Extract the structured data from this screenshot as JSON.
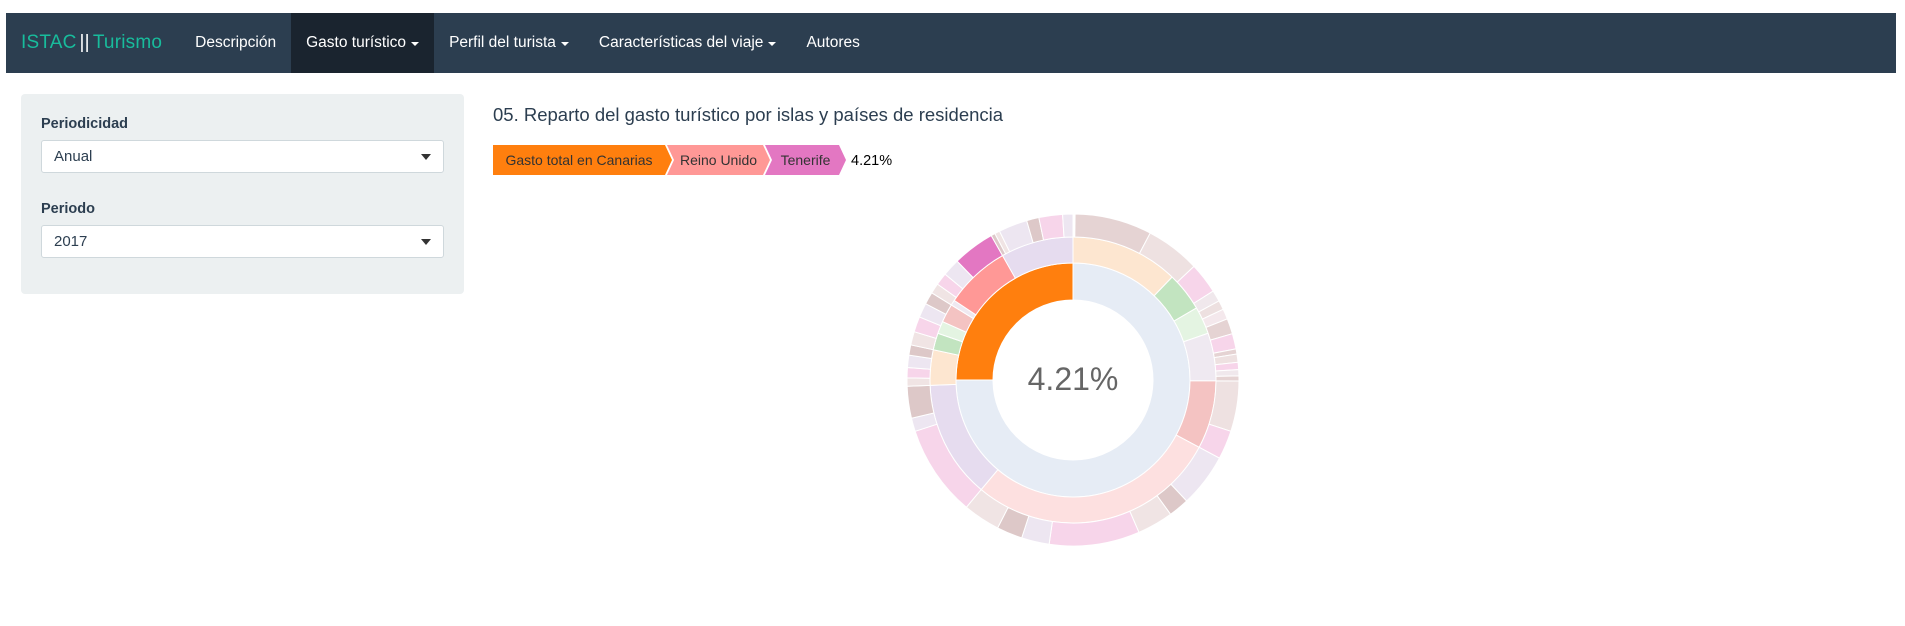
{
  "navbar": {
    "brand_left": "ISTAC",
    "brand_sep": "||",
    "brand_right": "Turismo",
    "items": [
      {
        "label": "Descripción",
        "dropdown": false,
        "active": false
      },
      {
        "label": "Gasto turístico",
        "dropdown": true,
        "active": true
      },
      {
        "label": "Perfil del turista",
        "dropdown": true,
        "active": false
      },
      {
        "label": "Características del viaje",
        "dropdown": true,
        "active": false
      },
      {
        "label": "Autores",
        "dropdown": false,
        "active": false
      }
    ]
  },
  "sidebar": {
    "periodicidad_label": "Periodicidad",
    "periodicidad_value": "Anual",
    "periodo_label": "Periodo",
    "periodo_value": "2017"
  },
  "main": {
    "title": "05. Reparto del gasto turístico por islas y países de residencia"
  },
  "colors": {
    "navbar": "#2c3e50",
    "brand": "#18bc9c",
    "highlight_total": "#ff7f0e",
    "highlight_country": "#ff9896",
    "highlight_island": "#e377c2"
  },
  "chart_data": {
    "type": "sunburst",
    "center_label": "4.21%",
    "breadcrumb": [
      {
        "label": "Gasto total en Canarias",
        "color": "#ff7f0e"
      },
      {
        "label": "Reino Unido",
        "color": "#ff9896"
      },
      {
        "label": "Tenerife",
        "color": "#e377c2"
      }
    ],
    "breadcrumb_value": "4.21%",
    "highlighted_path": [
      "Gasto total en Canarias",
      "Reino Unido",
      "Tenerife"
    ],
    "rings": [
      {
        "level": 1,
        "segments": [
          {
            "start": 0.0,
            "end": 0.75,
            "color": "#e6ecf5"
          },
          {
            "start": 0.75,
            "end": 1.0,
            "color": "#ff7f0e"
          }
        ]
      },
      {
        "level": 2,
        "segments": [
          {
            "start": 0.0,
            "end": 0.122,
            "color": "#fde6d0"
          },
          {
            "start": 0.122,
            "end": 0.166,
            "color": "#c2e4c0"
          },
          {
            "start": 0.166,
            "end": 0.197,
            "color": "#e4f4e2"
          },
          {
            "start": 0.197,
            "end": 0.251,
            "color": "#efe9f1"
          },
          {
            "start": 0.251,
            "end": 0.328,
            "color": "#f4c3c2"
          },
          {
            "start": 0.328,
            "end": 0.611,
            "color": "#fde0e0"
          },
          {
            "start": 0.611,
            "end": 0.744,
            "color": "#e6dcef"
          },
          {
            "start": 0.744,
            "end": 0.784,
            "color": "#fde6d0"
          },
          {
            "start": 0.784,
            "end": 0.803,
            "color": "#c2e4c0"
          },
          {
            "start": 0.803,
            "end": 0.817,
            "color": "#e4f4e2"
          },
          {
            "start": 0.817,
            "end": 0.838,
            "color": "#f4c3c2"
          },
          {
            "start": 0.838,
            "end": 0.844,
            "color": "#efe9f1"
          },
          {
            "start": 0.844,
            "end": 0.918,
            "color": "#ff9896"
          },
          {
            "start": 0.918,
            "end": 1.0,
            "color": "#e6dcef"
          }
        ]
      },
      {
        "level": 3,
        "segments": [
          {
            "start": 0.002,
            "end": 0.077,
            "color": "#e5d3d3"
          },
          {
            "start": 0.077,
            "end": 0.13,
            "color": "#eee1e1"
          },
          {
            "start": 0.13,
            "end": 0.16,
            "color": "#f7d5ea"
          },
          {
            "start": 0.16,
            "end": 0.171,
            "color": "#f0e8ec"
          },
          {
            "start": 0.171,
            "end": 0.18,
            "color": "#ede0e0"
          },
          {
            "start": 0.18,
            "end": 0.19,
            "color": "#f4e8ec"
          },
          {
            "start": 0.19,
            "end": 0.205,
            "color": "#e5d3d3"
          },
          {
            "start": 0.205,
            "end": 0.22,
            "color": "#f7d5ea"
          },
          {
            "start": 0.22,
            "end": 0.225,
            "color": "#e5d3d3"
          },
          {
            "start": 0.225,
            "end": 0.233,
            "color": "#eee1e1"
          },
          {
            "start": 0.233,
            "end": 0.24,
            "color": "#f7d5ea"
          },
          {
            "start": 0.24,
            "end": 0.246,
            "color": "#f0e8ec"
          },
          {
            "start": 0.246,
            "end": 0.251,
            "color": "#e5d3d3"
          },
          {
            "start": 0.251,
            "end": 0.3,
            "color": "#eee1e1"
          },
          {
            "start": 0.3,
            "end": 0.328,
            "color": "#f7d5ea"
          },
          {
            "start": 0.328,
            "end": 0.38,
            "color": "#ede6f1"
          },
          {
            "start": 0.38,
            "end": 0.4,
            "color": "#ddc8c8"
          },
          {
            "start": 0.4,
            "end": 0.435,
            "color": "#f0e4e4"
          },
          {
            "start": 0.435,
            "end": 0.523,
            "color": "#f7d5ea"
          },
          {
            "start": 0.523,
            "end": 0.55,
            "color": "#ede6f1"
          },
          {
            "start": 0.55,
            "end": 0.575,
            "color": "#ddc8c8"
          },
          {
            "start": 0.575,
            "end": 0.611,
            "color": "#f0e4e4"
          },
          {
            "start": 0.611,
            "end": 0.7,
            "color": "#f7d5ea"
          },
          {
            "start": 0.7,
            "end": 0.713,
            "color": "#ede6f1"
          },
          {
            "start": 0.713,
            "end": 0.744,
            "color": "#ddc8c8"
          },
          {
            "start": 0.744,
            "end": 0.752,
            "color": "#f0e4e4"
          },
          {
            "start": 0.752,
            "end": 0.762,
            "color": "#f7d5ea"
          },
          {
            "start": 0.762,
            "end": 0.774,
            "color": "#ede6f1"
          },
          {
            "start": 0.774,
            "end": 0.784,
            "color": "#ddc8c8"
          },
          {
            "start": 0.784,
            "end": 0.797,
            "color": "#f0e4e4"
          },
          {
            "start": 0.797,
            "end": 0.812,
            "color": "#f7d5ea"
          },
          {
            "start": 0.812,
            "end": 0.826,
            "color": "#ede6f1"
          },
          {
            "start": 0.826,
            "end": 0.838,
            "color": "#ddc8c8"
          },
          {
            "start": 0.838,
            "end": 0.848,
            "color": "#f0e4e4"
          },
          {
            "start": 0.848,
            "end": 0.86,
            "color": "#f7d5ea"
          },
          {
            "start": 0.86,
            "end": 0.877,
            "color": "#ede6f1"
          },
          {
            "start": 0.877,
            "end": 0.918,
            "color": "#e377c2"
          },
          {
            "start": 0.918,
            "end": 0.922,
            "color": "#ddc8c8"
          },
          {
            "start": 0.922,
            "end": 0.927,
            "color": "#f0e4e4"
          },
          {
            "start": 0.927,
            "end": 0.955,
            "color": "#ede6f1"
          },
          {
            "start": 0.955,
            "end": 0.967,
            "color": "#ddc8c8"
          },
          {
            "start": 0.967,
            "end": 0.99,
            "color": "#f7d5ea"
          },
          {
            "start": 0.99,
            "end": 1.0,
            "color": "#ede6f1"
          }
        ]
      }
    ]
  }
}
